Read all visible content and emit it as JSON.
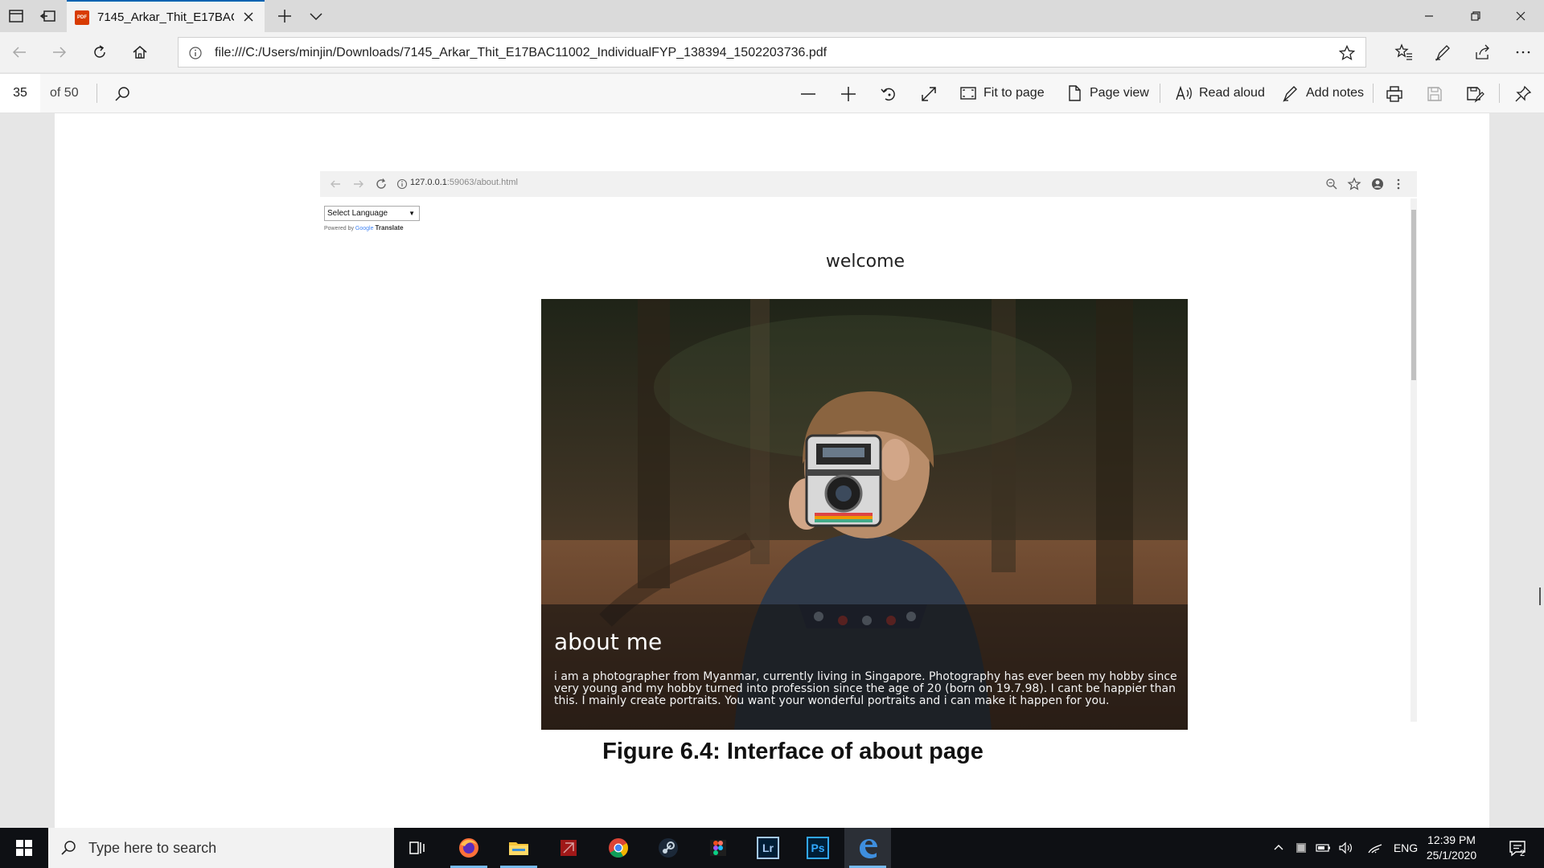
{
  "browser": {
    "tab_title": "7145_Arkar_Thit_E17BAC",
    "tab_icon": "pdf-icon",
    "new_tab_label": "+",
    "url": "file:///C:/Users/minjin/Downloads/7145_Arkar_Thit_E17BAC11002_IndividualFYP_138394_1502203736.pdf"
  },
  "pdf_toolbar": {
    "page_number": "35",
    "page_total": "of 50",
    "fit_label": "Fit to page",
    "page_view_label": "Page view",
    "read_aloud_label": "Read aloud",
    "add_notes_label": "Add notes"
  },
  "embedded_page": {
    "url_host": "127.0.0.1",
    "url_rest": ":59063/about.html",
    "language_select": "Select Language",
    "powered_by": "Powered by",
    "google_label": "Google",
    "translate_label": "Translate",
    "welcome": "welcome",
    "about_title": "about me",
    "about_text": "i am a photographer from Myanmar, currently living in Singapore. Photography has ever been my hobby since very young and my hobby turned into profession since the age of 20 (born on 19.7.98). I cant be happier than this. I mainly create portraits. You want your wonderful portraits and i can make it happen for you."
  },
  "caption": "Figure 6.4: Interface of about page",
  "taskbar": {
    "search_placeholder": "Type here to search",
    "apps": [
      "task-view-icon",
      "firefox-icon",
      "file-explorer-icon",
      "red-app-icon",
      "chrome-icon",
      "steam-icon",
      "figma-icon",
      "lightroom-icon",
      "photoshop-icon",
      "edge-icon"
    ],
    "lightroom_label": "Lr",
    "photoshop_label": "Ps",
    "language": "ENG",
    "time": "12:39 PM",
    "date": "25/1/2020",
    "notification_count": "2"
  },
  "colors": {
    "accent": "#0063b1",
    "taskbar": "#0e1014",
    "pdf_badge": "#d83b01"
  }
}
